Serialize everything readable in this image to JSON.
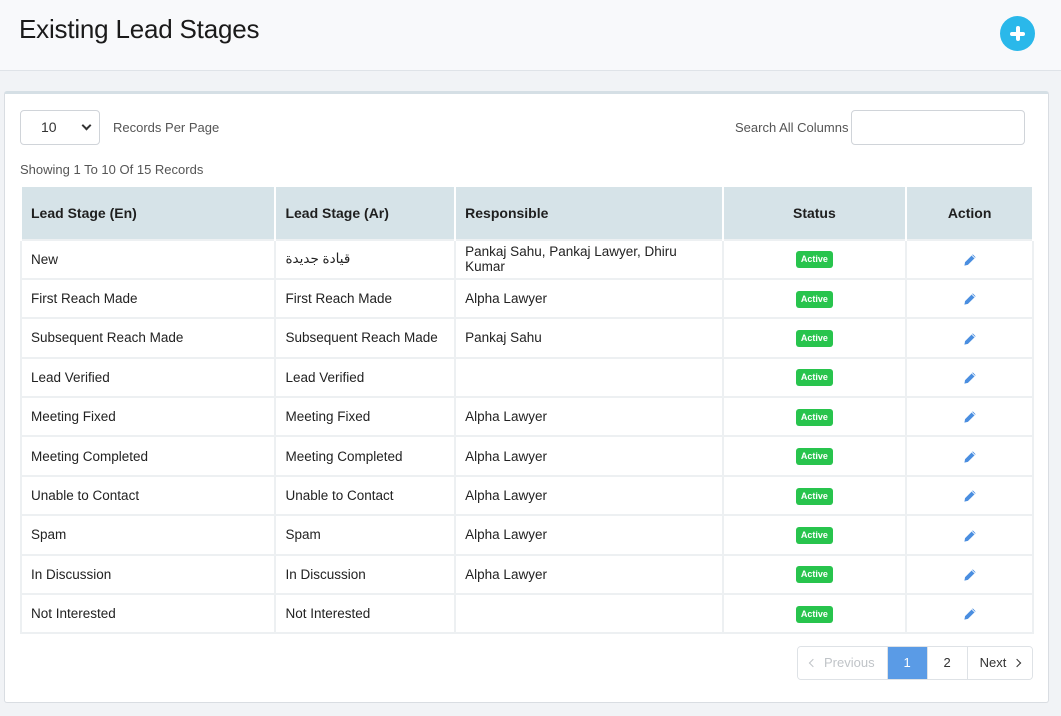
{
  "header": {
    "title": "Existing Lead Stages",
    "add_icon": "plus-circle-icon",
    "accent": "#2ab8ea"
  },
  "controls": {
    "per_page_value": "10",
    "per_page_label": "Records Per Page",
    "search_label": "Search All Columns",
    "search_value": "",
    "records_info": "Showing 1 To 10 Of 15 Records"
  },
  "table": {
    "columns": [
      "Lead Stage (En)",
      "Lead Stage (Ar)",
      "Responsible",
      "Status",
      "Action"
    ],
    "rows": [
      {
        "en": "New",
        "ar": "قيادة جديدة",
        "responsible": "Pankaj Sahu, Pankaj Lawyer, Dhiru Kumar",
        "status": "Active"
      },
      {
        "en": "First Reach Made",
        "ar": "First Reach Made",
        "responsible": "Alpha Lawyer",
        "status": "Active"
      },
      {
        "en": "Subsequent Reach Made",
        "ar": "Subsequent Reach Made",
        "responsible": "Pankaj Sahu",
        "status": "Active"
      },
      {
        "en": "Lead Verified",
        "ar": "Lead Verified",
        "responsible": "",
        "status": "Active"
      },
      {
        "en": "Meeting Fixed",
        "ar": "Meeting Fixed",
        "responsible": "Alpha Lawyer",
        "status": "Active"
      },
      {
        "en": "Meeting Completed",
        "ar": "Meeting Completed",
        "responsible": "Alpha Lawyer",
        "status": "Active"
      },
      {
        "en": "Unable to Contact",
        "ar": "Unable to Contact",
        "responsible": "Alpha Lawyer",
        "status": "Active"
      },
      {
        "en": "Spam",
        "ar": "Spam",
        "responsible": "Alpha Lawyer",
        "status": "Active"
      },
      {
        "en": "In Discussion",
        "ar": "In Discussion",
        "responsible": "Alpha Lawyer",
        "status": "Active"
      },
      {
        "en": "Not Interested",
        "ar": "Not Interested",
        "responsible": "",
        "status": "Active"
      }
    ],
    "status_color": "#28c44d",
    "edit_icon": "pencil-icon"
  },
  "pagination": {
    "previous": "Previous",
    "pages": [
      "1",
      "2"
    ],
    "current": "1",
    "next": "Next"
  }
}
